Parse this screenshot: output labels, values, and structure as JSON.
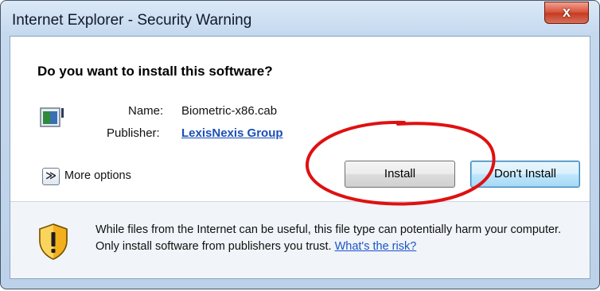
{
  "window": {
    "title": "Internet Explorer - Security Warning",
    "close_glyph": "x"
  },
  "dialog": {
    "question": "Do you want to install this software?",
    "file_icon": "cab-file-icon",
    "name_label": "Name:",
    "name_value": "Biometric-x86.cab",
    "publisher_label": "Publisher:",
    "publisher_value": "LexisNexis Group",
    "more_options_glyph": "≫",
    "more_options_label": "More options",
    "install_label": "Install",
    "dont_install_label": "Don't Install"
  },
  "warning": {
    "icon": "security-shield-icon",
    "text": "While files from the Internet can be useful, this file type can potentially harm your computer. Only install software from publishers you trust.",
    "risk_link": "What's the risk?"
  },
  "colors": {
    "link": "#1a4fb8",
    "annotation_circle": "#e01010",
    "close_button": "#c43b22"
  }
}
